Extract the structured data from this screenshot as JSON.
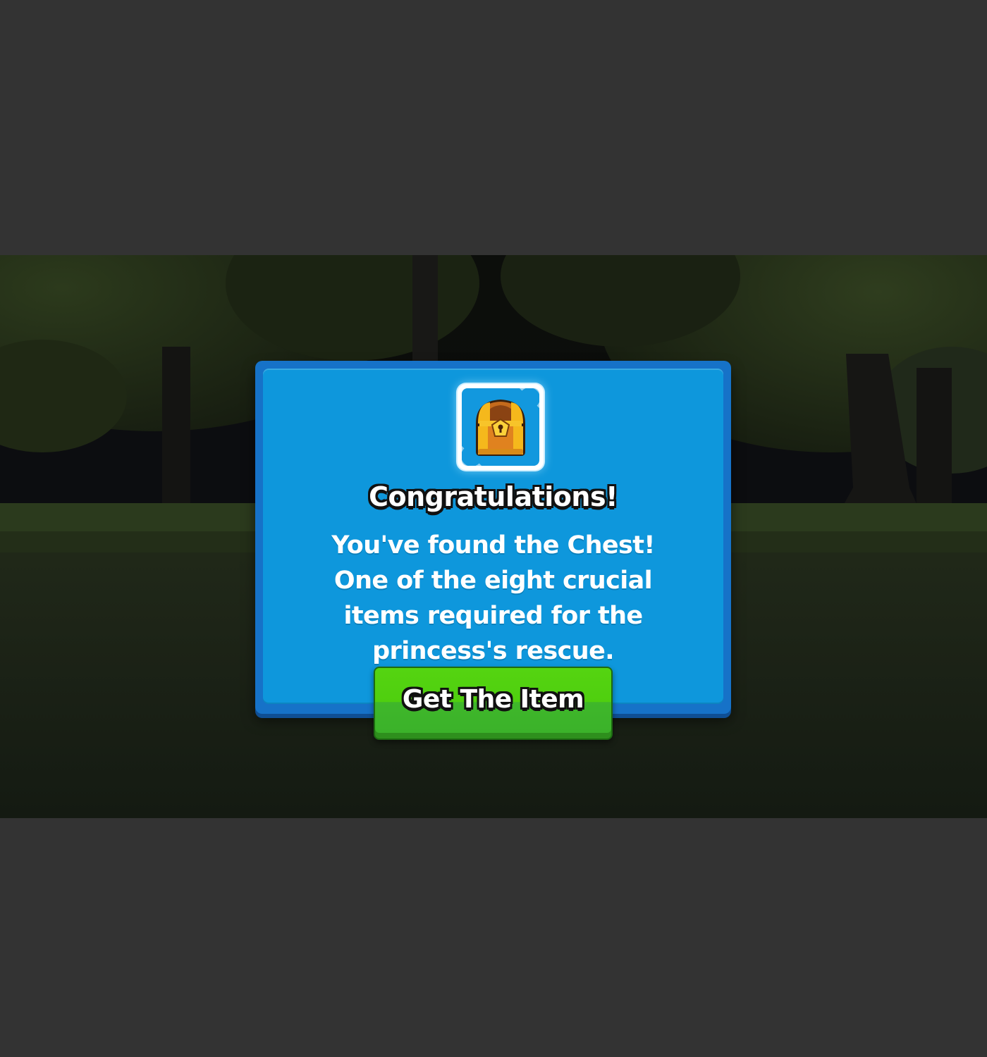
{
  "colors": {
    "backdrop": "#333333",
    "dialog_border": "#1672c8",
    "dialog_fill": "#0e97dc",
    "button_green": "#4fcf0f",
    "text_white": "#ffffff"
  },
  "scene": {
    "background": "dark forest at night"
  },
  "dialog": {
    "item_icon": "treasure-chest-icon",
    "title": "Congratulations!",
    "message": "You've found the Chest! One of the eight crucial items required for the princess's rescue.",
    "button_label": "Get The Item"
  }
}
